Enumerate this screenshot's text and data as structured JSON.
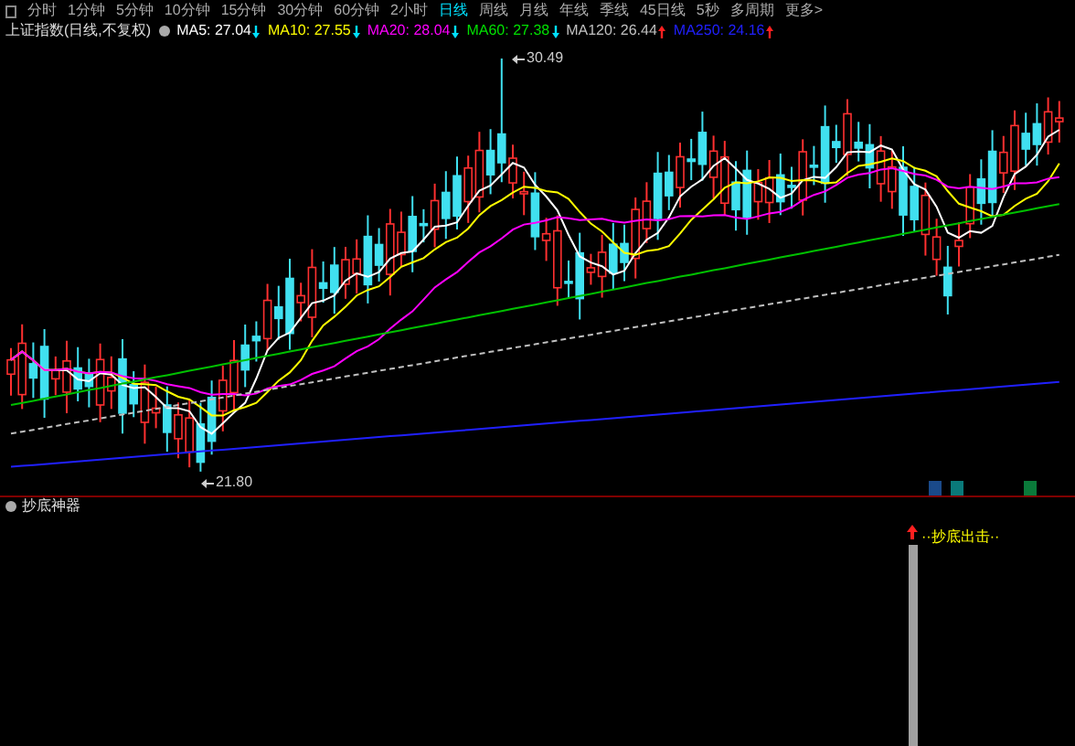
{
  "period_tabs": [
    {
      "label": "分时",
      "selected": false
    },
    {
      "label": "1分钟",
      "selected": false
    },
    {
      "label": "5分钟",
      "selected": false
    },
    {
      "label": "10分钟",
      "selected": false
    },
    {
      "label": "15分钟",
      "selected": false
    },
    {
      "label": "30分钟",
      "selected": false
    },
    {
      "label": "60分钟",
      "selected": false
    },
    {
      "label": "2小时",
      "selected": false
    },
    {
      "label": "日线",
      "selected": true
    },
    {
      "label": "周线",
      "selected": false
    },
    {
      "label": "月线",
      "selected": false
    },
    {
      "label": "年线",
      "selected": false
    },
    {
      "label": "季线",
      "selected": false
    },
    {
      "label": "45日线",
      "selected": false
    },
    {
      "label": "5秒",
      "selected": false
    },
    {
      "label": "多周期",
      "selected": false
    },
    {
      "label": "更多>",
      "selected": false
    }
  ],
  "legend": {
    "title": "上证指数(日线,不复权)",
    "averages": [
      {
        "label": "MA5: 27.04",
        "rising": false,
        "color": "#ffffff"
      },
      {
        "label": "MA10: 27.55",
        "rising": false,
        "color": "#ffff00"
      },
      {
        "label": "MA20: 28.04",
        "rising": false,
        "color": "#ff00ff"
      },
      {
        "label": "MA60: 27.38",
        "rising": false,
        "color": "#00e000"
      },
      {
        "label": "MA120: 26.44",
        "rising": true,
        "color": "#c0c0c0"
      },
      {
        "label": "MA250: 24.16",
        "rising": true,
        "color": "#2020ff"
      }
    ]
  },
  "price_chart": {
    "high_label": "30.49",
    "low_label": "21.80"
  },
  "indicator_panel": {
    "title": "抄底神器",
    "signal": "··抄底出击··"
  }
}
